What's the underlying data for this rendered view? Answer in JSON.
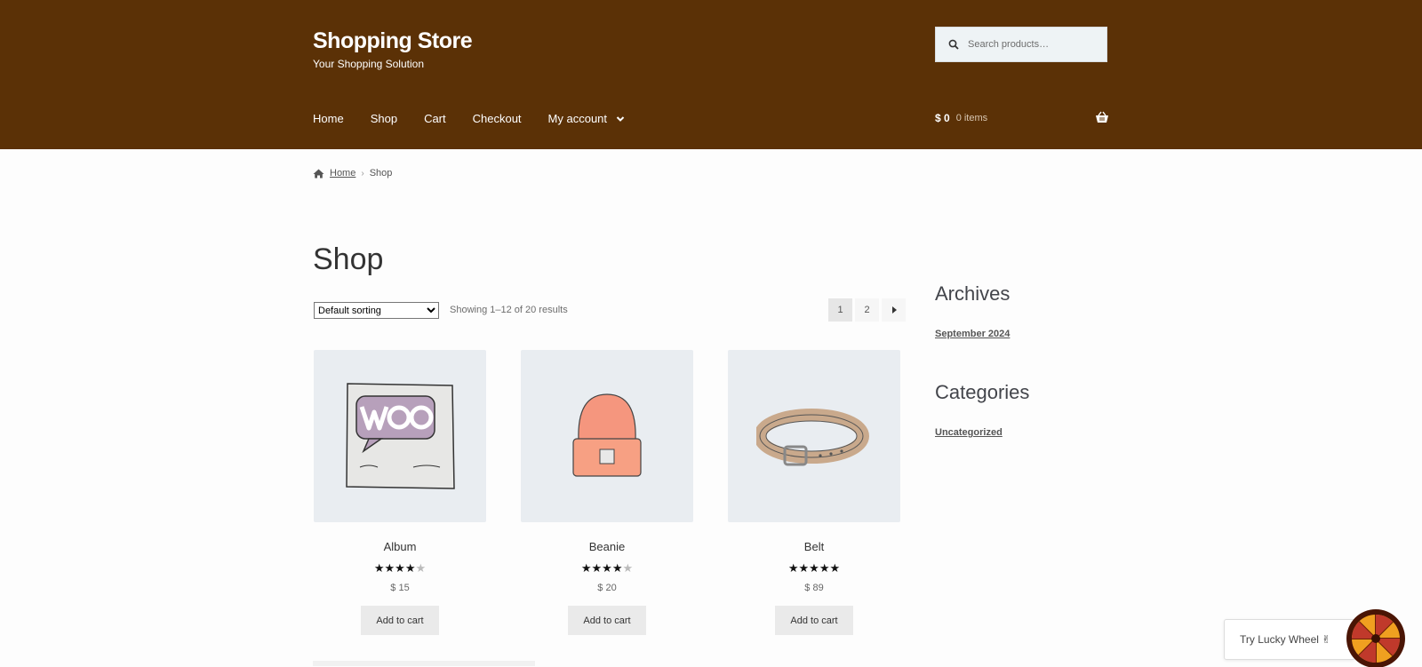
{
  "header": {
    "site_title": "Shopping Store",
    "site_description": "Your Shopping Solution",
    "search_placeholder": "Search products…",
    "nav": [
      "Home",
      "Shop",
      "Cart",
      "Checkout",
      "My account"
    ],
    "cart_amount": "$ 0",
    "cart_items": "0 items",
    "background_color": "#5b3106"
  },
  "breadcrumb": {
    "home": "Home",
    "current": "Shop"
  },
  "main": {
    "title": "Shop",
    "sort_selected": "Default sorting",
    "result_count": "Showing 1–12 of 20 results",
    "pages": [
      "1",
      "2"
    ],
    "products": [
      {
        "name": "Album",
        "rating": 3.75,
        "price": "$ 15",
        "button": "Add to cart"
      },
      {
        "name": "Beanie",
        "rating": 4,
        "price": "$ 20",
        "button": "Add to cart"
      },
      {
        "name": "Belt",
        "rating": 5,
        "price": "$ 89",
        "button": "Add to cart"
      }
    ]
  },
  "sidebar": {
    "archives_title": "Archives",
    "archives_link": "September 2024",
    "categories_title": "Categories",
    "categories_link": "Uncategorized"
  },
  "lucky_wheel": {
    "label": "Try Lucky Wheel ✌"
  },
  "icons": [
    "search-icon",
    "chevron-down-icon",
    "basket-icon",
    "home-icon",
    "next-arrow-icon",
    "lucky-wheel-icon"
  ]
}
